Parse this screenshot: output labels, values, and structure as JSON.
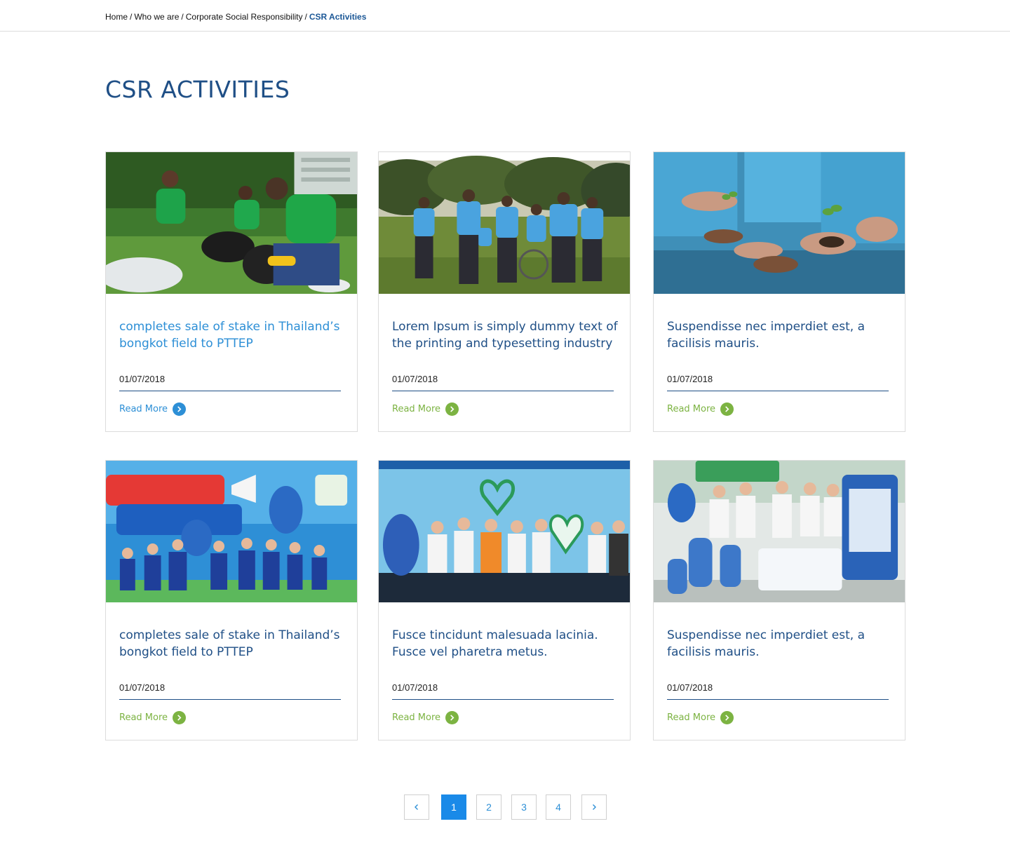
{
  "breadcrumb": {
    "items": [
      "Home",
      "Who we are",
      "Corporate Social Responsibility"
    ],
    "current": "CSR Activities",
    "separator": "/"
  },
  "page_title": "CSR ACTIVITIES",
  "cards": [
    {
      "title": "completes sale of stake in Thailand’s bongkot field to PTTEP",
      "date": "01/07/2018",
      "read_more": "Read More",
      "image": "volunteers-cleaning-park",
      "highlighted": true
    },
    {
      "title": "Lorem Ipsum is simply dummy text of the printing and typesetting industry",
      "date": "01/07/2018",
      "read_more": "Read More",
      "image": "volunteers-walking-field",
      "highlighted": false
    },
    {
      "title": "Suspendisse nec imperdiet est, a facilisis mauris.",
      "date": "01/07/2018",
      "read_more": "Read More",
      "image": "hands-holding-seedlings",
      "highlighted": false
    },
    {
      "title": "completes sale of stake in Thailand’s bongkot field to PTTEP",
      "date": "01/07/2018",
      "read_more": "Read More",
      "image": "mascot-event-banner",
      "highlighted": false
    },
    {
      "title": "Fusce tincidunt malesuada lacinia. Fusce vel pharetra metus.",
      "date": "01/07/2018",
      "read_more": "Read More",
      "image": "group-photo-stage",
      "highlighted": false
    },
    {
      "title": "Suspendisse nec imperdiet est, a facilisis mauris.",
      "date": "01/07/2018",
      "read_more": "Read More",
      "image": "gas-cylinder-booth",
      "highlighted": false
    }
  ],
  "pagination": {
    "prev_icon": "chevron-left-icon",
    "pages": [
      "1",
      "2",
      "3",
      "4"
    ],
    "current_page": "1",
    "next_icon": "chevron-right-icon"
  },
  "colors": {
    "title_blue": "#1f4f86",
    "highlight_blue": "#2d8fd6",
    "link_green": "#7cb342",
    "active_page": "#1a8ae8"
  }
}
